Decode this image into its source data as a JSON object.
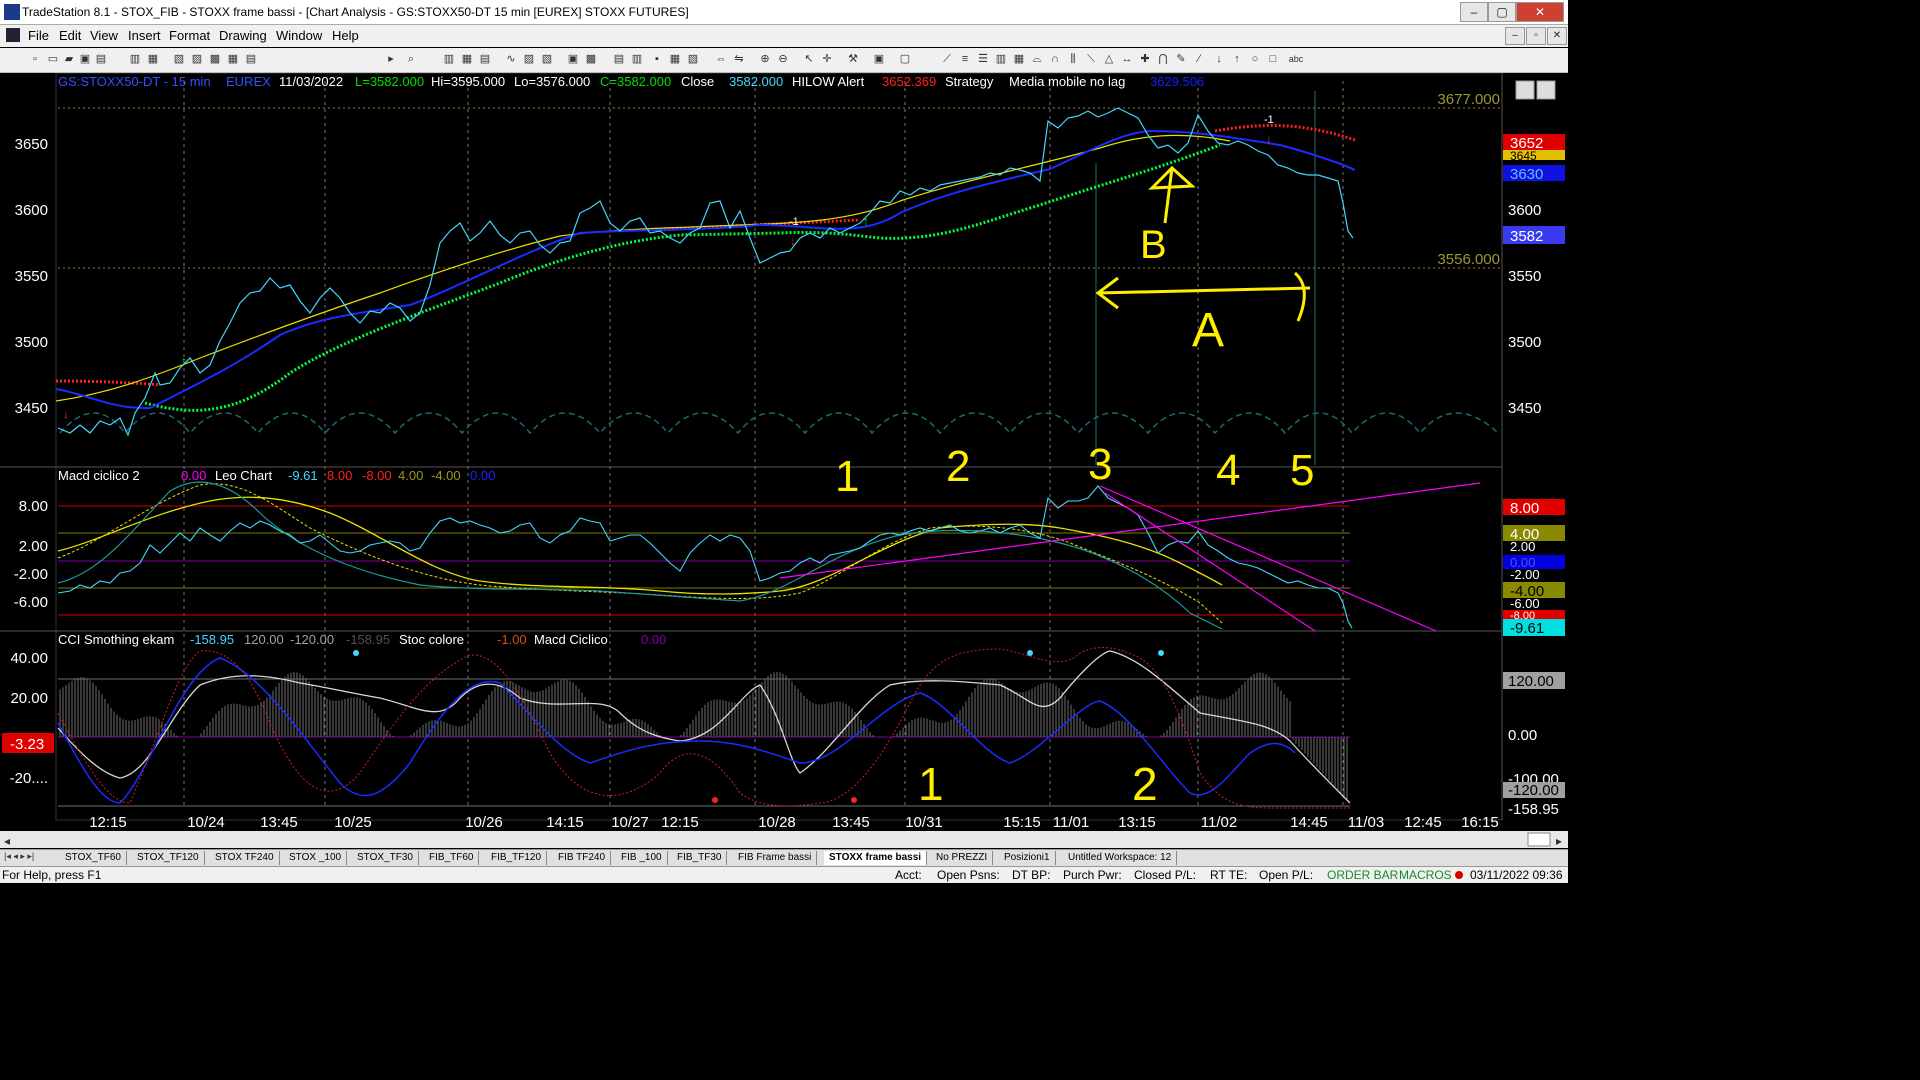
{
  "window": {
    "title": "TradeStation 8.1 - STOX_FIB - STOXX frame bassi - [Chart Analysis - GS:STOXX50-DT  15 min  [EUREX] STOXX FUTURES]",
    "min": "‒",
    "max": "▢",
    "close": "✕"
  },
  "menu": [
    "File",
    "Edit",
    "View",
    "Insert",
    "Format",
    "Drawing",
    "Window",
    "Help"
  ],
  "toolbar": {
    "symbol_value": "R"
  },
  "header": {
    "symbol": "GS:STOXX50-DT - 15 min",
    "exchange": "EUREX",
    "date": "11/03/2022",
    "last": "L=3582.000",
    "hi": "Hi=3595.000",
    "lo": "Lo=3576.000",
    "close_v": "C=3582.000",
    "close_label": "Close",
    "close_val": "3582.000",
    "hilow": "HILOW Alert",
    "hilow_val": "3652.369",
    "strategy": "Strategy",
    "media": "Media mobile no lag",
    "media_val": "3629.506"
  },
  "price_panel": {
    "y_ticks": [
      "3650",
      "3600",
      "3550",
      "3500",
      "3450"
    ],
    "level_hi": "3677.000",
    "level_lo": "3556.000",
    "right_labels": [
      {
        "text": "3652",
        "bg": "#e00000",
        "fg": "#ffffff"
      },
      {
        "text": "3645",
        "bg": "#e0c000",
        "fg": "#000000"
      },
      {
        "text": "3630",
        "bg": "#1010e0",
        "fg": "#5bc0ff"
      },
      {
        "text": "3582",
        "bg": "#3a3af0",
        "fg": "#ffffff"
      }
    ],
    "annotations": {
      "a_label": "A",
      "b_label": "B",
      "minus1": "-1"
    }
  },
  "macd_panel": {
    "title": "Macd ciclico 2",
    "v1": "0.00",
    "leo": "Leo Chart",
    "v2": "-9.61",
    "v3": "8.00",
    "v4": "-8.00",
    "v5": "4.00",
    "v6": "-4.00",
    "v7": "0.00",
    "y_ticks": [
      "8.00",
      "2.00",
      "-2.00",
      "-6.00"
    ],
    "right_labels": [
      {
        "text": "8.00",
        "bg": "#e00000",
        "fg": "#ffffff"
      },
      {
        "text": "4.00",
        "bg": "#8a8a00",
        "fg": "#ffffff"
      },
      {
        "text": "2.00",
        "bg": "#000000",
        "fg": "#ffffff"
      },
      {
        "text": "0.00",
        "bg": "#0000e0",
        "fg": "#5050ff"
      },
      {
        "text": "-2.00",
        "bg": "#000000",
        "fg": "#ffffff"
      },
      {
        "text": "-4.00",
        "bg": "#8a8a00",
        "fg": "#000000"
      },
      {
        "text": "-6.00",
        "bg": "#000000",
        "fg": "#ffffff"
      },
      {
        "text": "-8.00",
        "bg": "#e00000",
        "fg": "#ffffff"
      },
      {
        "text": "-9.61",
        "bg": "#00e0e0",
        "fg": "#000000"
      }
    ],
    "cycle_numbers": [
      "1",
      "2",
      "3",
      "4",
      "5"
    ]
  },
  "cci_panel": {
    "title": "CCI Smothing ekam",
    "v1": "-158.95",
    "v2": "120.00",
    "v3": "-120.00",
    "v4": "-158.95",
    "stoc": "Stoc colore",
    "stoc_val": "-1.00",
    "macd": "Macd Ciclico",
    "macd_val": "0.00",
    "y_ticks": [
      "40.00",
      "20.00",
      "-20...."
    ],
    "left_badges": [
      "-3.23"
    ],
    "right_labels": [
      {
        "text": "120.00",
        "bg": "#a0a0a0",
        "fg": "#000000"
      },
      {
        "text": "0.00",
        "bg": "#000000",
        "fg": "#ffffff"
      },
      {
        "text": "-100.00",
        "bg": "#000000",
        "fg": "#ffffff"
      },
      {
        "text": "-120.00",
        "bg": "#a0a0a0",
        "fg": "#000000"
      },
      {
        "text": "-158.95",
        "bg": "#000000",
        "fg": "#ffffff"
      }
    ],
    "annotations": [
      "1",
      "2"
    ]
  },
  "x_axis": [
    "12:15",
    "10/24",
    "13:45",
    "10/25",
    "10/26",
    "14:15",
    "10/27",
    "12:15",
    "10/28",
    "13:45",
    "10/31",
    "15:15",
    "11/01",
    "13:15",
    "11/02",
    "14:45",
    "11/03",
    "12:45",
    "16:15"
  ],
  "tabs": [
    "STOX_TF60",
    "STOX_TF120",
    "STOX TF240",
    "STOX _100",
    "STOX_TF30",
    "FIB_TF60",
    "FIB_TF120",
    "FIB TF240",
    "FIB _100",
    "FIB_TF30",
    "FIB Frame bassi",
    "STOXX frame bassi",
    "No PREZZI",
    "Posizioni1",
    "Untitled Workspace:  12"
  ],
  "status": {
    "help": "For Help, press F1",
    "acct": "Acct:",
    "open_psns": "Open Psns:",
    "dt_bp": "DT BP:",
    "purch_pwr": "Purch Pwr:",
    "closed_pl": "Closed P/L:",
    "rt_te": "RT TE:",
    "open_pl": "Open P/L:",
    "order_bar": "ORDER BAR",
    "macros": "MACROS",
    "datetime": "03/11/2022 09:36"
  },
  "colors": {
    "price": "#40d8ff",
    "ema_blue": "#1a2cff",
    "ema_yellow": "#e8e000",
    "stop_green": "#00ff40",
    "stop_red": "#ff2020",
    "magenta": "#ff00ff"
  }
}
